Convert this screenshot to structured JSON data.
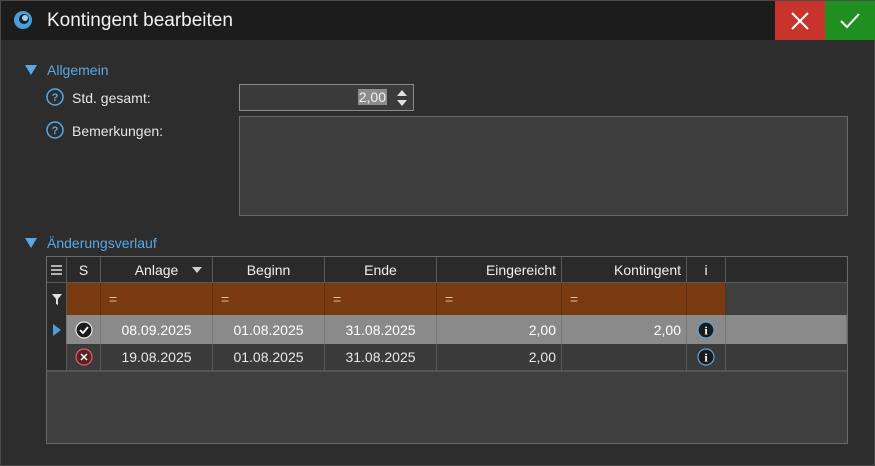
{
  "window": {
    "title": "Kontingent bearbeiten",
    "accent_cancel": "#c8332b",
    "accent_ok": "#1f8f1f"
  },
  "section_general": {
    "label": "Allgemein"
  },
  "fields": {
    "std_label": "Std. gesamt:",
    "std_value": "2,00",
    "remarks_label": "Bemerkungen:",
    "remarks_value": ""
  },
  "section_history": {
    "label": "Änderungsverlauf"
  },
  "grid": {
    "columns": [
      "S",
      "Anlage",
      "Beginn",
      "Ende",
      "Eingereicht",
      "Kontingent",
      "i"
    ],
    "filter_symbol": "=",
    "rows": [
      {
        "status": "approved",
        "anlage": "08.09.2025",
        "beginn": "01.08.2025",
        "ende": "31.08.2025",
        "eingereicht": "2,00",
        "kontingent": "2,00"
      },
      {
        "status": "rejected",
        "anlage": "19.08.2025",
        "beginn": "01.08.2025",
        "ende": "31.08.2025",
        "eingereicht": "2,00",
        "kontingent": ""
      }
    ]
  },
  "icons": {
    "app": "app-logo-icon",
    "cancel": "close-icon",
    "ok": "check-icon",
    "help": "help-icon",
    "menu": "hamburger-icon",
    "filter": "filter-icon",
    "row_pointer": "row-pointer-icon",
    "info": "info-icon"
  }
}
